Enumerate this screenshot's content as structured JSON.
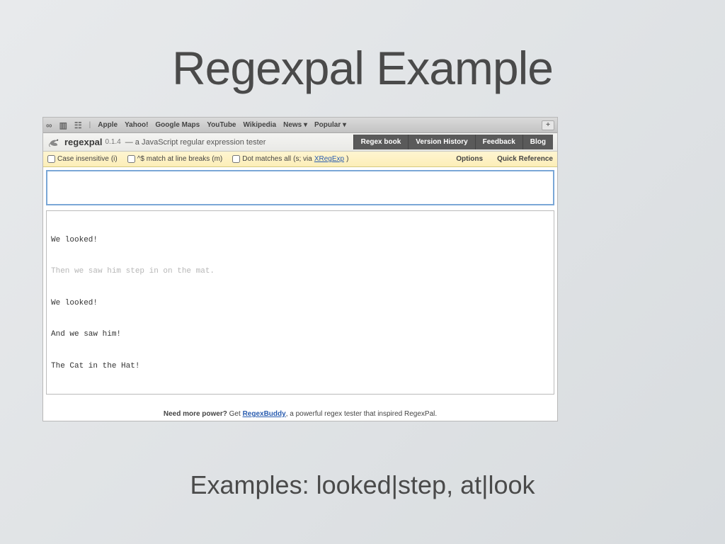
{
  "slide": {
    "title": "Regexpal Example",
    "caption": "Examples: looked|step, at|look"
  },
  "browser": {
    "bookmarks": [
      "Apple",
      "Yahoo!",
      "Google Maps",
      "YouTube",
      "Wikipedia",
      "News ▾",
      "Popular ▾"
    ]
  },
  "regexpal": {
    "brand": "regexpal",
    "version": "0.1.4",
    "tagline": "— a JavaScript regular expression tester",
    "tabs": [
      "Regex book",
      "Version History",
      "Feedback",
      "Blog"
    ],
    "options": {
      "case_insensitive": {
        "label": "Case insensitive",
        "flag": "(i)",
        "checked": false
      },
      "match_linebreaks": {
        "label": "^$ match at line breaks",
        "flag": "(m)",
        "checked": false
      },
      "dot_matches_all": {
        "label": "Dot matches all",
        "flag": "(s; via ",
        "checked": false
      },
      "xregexp_label": "XRegExp",
      "xregexp_suffix": ")",
      "right": [
        "Options",
        "Quick Reference"
      ]
    },
    "regex_value": "",
    "test_lines": [
      {
        "text": "We looked!",
        "dim": false
      },
      {
        "text": "Then we saw him step in on the mat.",
        "dim": true
      },
      {
        "text": "We looked!",
        "dim": false
      },
      {
        "text": "And we saw him!",
        "dim": false
      },
      {
        "text": "The Cat in the Hat!",
        "dim": false
      }
    ],
    "footer": {
      "lead": "Need more power?",
      "mid": " Get ",
      "link": "RegexBuddy",
      "tail": ", a powerful regex tester that inspired RegexPal."
    }
  }
}
